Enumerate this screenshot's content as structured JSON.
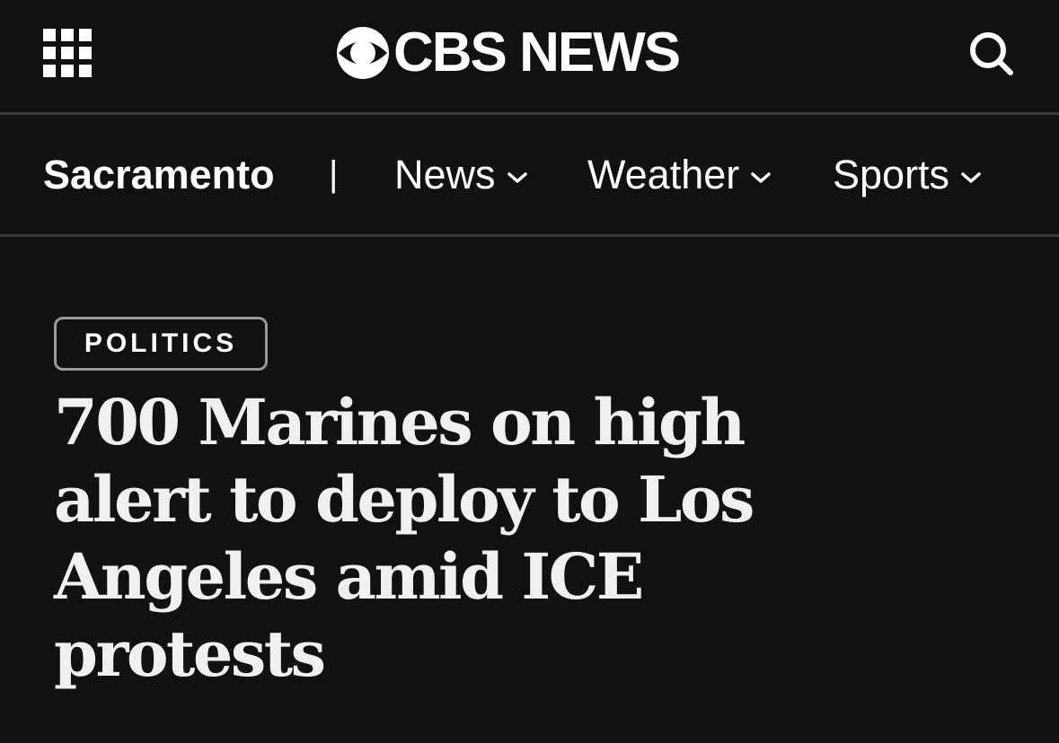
{
  "header": {
    "menu_icon": "grid-menu-icon",
    "logo_text": "CBS NEWS",
    "logo_icon": "cbs-eye-icon",
    "search_icon": "search-icon"
  },
  "nav": {
    "local_label": "Sacramento",
    "separator": "|",
    "items": [
      {
        "label": "News",
        "icon": "chevron-down-icon"
      },
      {
        "label": "Weather",
        "icon": "chevron-down-icon"
      },
      {
        "label": "Sports",
        "icon": "chevron-down-icon"
      }
    ]
  },
  "article": {
    "category": "POLITICS",
    "headline": "700 Marines on high alert to deploy to Los Angeles amid ICE protests"
  },
  "colors": {
    "background": "#111111",
    "text": "#ffffff",
    "divider": "#3a3a3a",
    "tag_border": "#9a9a9a"
  }
}
